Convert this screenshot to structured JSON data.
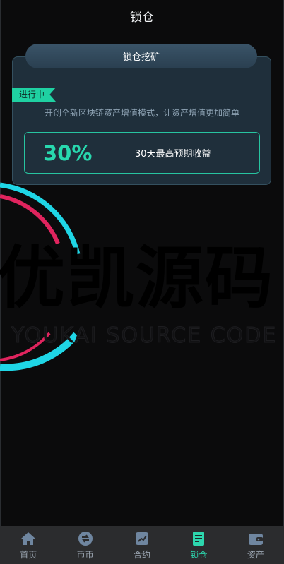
{
  "header": {
    "title": "锁仓"
  },
  "card": {
    "tab_label": "锁仓挖矿",
    "status_badge": "进行中",
    "description": "开创全新区块链资产增值模式，让资产增值更加简单",
    "stat_value": "30%",
    "stat_label": "30天最高预期收益"
  },
  "watermark": {
    "logo_text": "优凯源码",
    "sub_text": "YOUKAI SOURCE CODE"
  },
  "tabbar": {
    "items": [
      {
        "label": "首页",
        "icon": "home-icon",
        "active": false
      },
      {
        "label": "币币",
        "icon": "exchange-icon",
        "active": false
      },
      {
        "label": "合约",
        "icon": "contract-icon",
        "active": false
      },
      {
        "label": "锁仓",
        "icon": "lock-icon",
        "active": true
      },
      {
        "label": "资产",
        "icon": "wallet-icon",
        "active": false
      }
    ]
  },
  "colors": {
    "accent": "#2dd7ae",
    "card_bg": "#1f2f3b",
    "page_bg": "#0b0b0c"
  }
}
